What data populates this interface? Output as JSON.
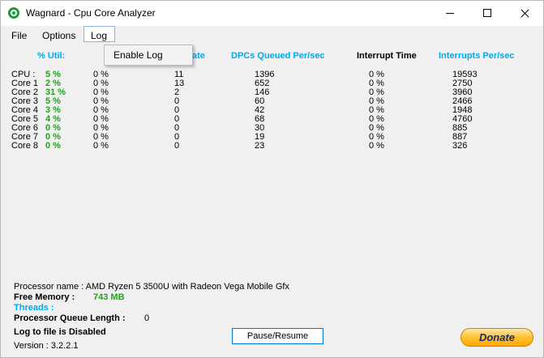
{
  "window": {
    "title": "Wagnard - Cpu Core Analyzer"
  },
  "menu": {
    "file": "File",
    "options": "Options",
    "log": "Log",
    "log_dropdown": [
      "Enable Log"
    ]
  },
  "headers": {
    "util": "% Util:",
    "ate": "ate",
    "dpcs_queued": "DPCs Queued Per/sec",
    "interrupt_time": "Interrupt Time",
    "interrupts": "Interrupts Per/sec"
  },
  "rows": [
    {
      "label": "CPU :",
      "util": "5 %",
      "c2": "0 %",
      "c3": "11",
      "dpcs": "1396",
      "itime": "0 %",
      "ints": "19593"
    },
    {
      "label": "Core 1",
      "util": "2 %",
      "c2": "0 %",
      "c3": "13",
      "dpcs": "652",
      "itime": "0 %",
      "ints": "2750"
    },
    {
      "label": "Core 2",
      "util": "31 %",
      "c2": "0 %",
      "c3": "2",
      "dpcs": "146",
      "itime": "0 %",
      "ints": "3960"
    },
    {
      "label": "Core 3",
      "util": "5 %",
      "c2": "0 %",
      "c3": "0",
      "dpcs": "60",
      "itime": "0 %",
      "ints": "2466"
    },
    {
      "label": "Core 4",
      "util": "3 %",
      "c2": "0 %",
      "c3": "0",
      "dpcs": "42",
      "itime": "0 %",
      "ints": "1948"
    },
    {
      "label": "Core 5",
      "util": "4 %",
      "c2": "0 %",
      "c3": "0",
      "dpcs": "68",
      "itime": "0 %",
      "ints": "4760"
    },
    {
      "label": "Core 6",
      "util": "0 %",
      "c2": "0 %",
      "c3": "0",
      "dpcs": "30",
      "itime": "0 %",
      "ints": "885"
    },
    {
      "label": "Core 7",
      "util": "0 %",
      "c2": "0 %",
      "c3": "0",
      "dpcs": "19",
      "itime": "0 %",
      "ints": "887"
    },
    {
      "label": "Core 8",
      "util": "0 %",
      "c2": "0 %",
      "c3": "0",
      "dpcs": "23",
      "itime": "0 %",
      "ints": "326"
    }
  ],
  "info": {
    "processor_name": "Processor name : AMD Ryzen 5 3500U with Radeon Vega Mobile Gfx",
    "free_memory_label": "Free Memory :",
    "free_memory_value": "743 MB",
    "threads_label": "Threads :",
    "queue_length_label": "Processor Queue Length :",
    "queue_length_value": "0",
    "log_status": "Log to file is Disabled",
    "version": "Version : 3.2.2.1"
  },
  "buttons": {
    "pause_resume": "Pause/Resume",
    "donate": "Donate"
  },
  "colors": {
    "header_blue": "#00aaee",
    "util_green": "#1da51d"
  }
}
